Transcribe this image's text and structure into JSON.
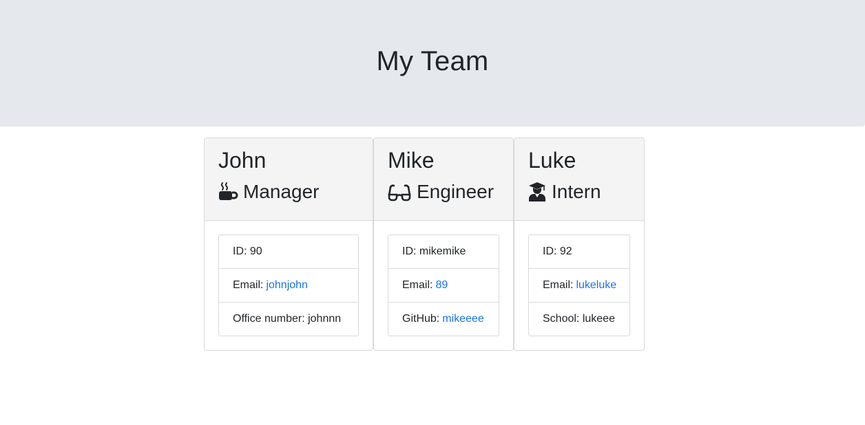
{
  "header": {
    "title": "My Team"
  },
  "cards": [
    {
      "name": "John",
      "role": "Manager",
      "role_icon": "coffee-icon",
      "id_label": "ID: 90",
      "email_label": "Email:",
      "email_value": "johnjohn",
      "extra_label": "Office number: johnnn",
      "extra_link": ""
    },
    {
      "name": "Mike",
      "role": "Engineer",
      "role_icon": "glasses-icon",
      "id_label": "ID: mikemike",
      "email_label": "Email:",
      "email_value": "89",
      "extra_label": "GitHub:",
      "extra_link": "mikeeee"
    },
    {
      "name": "Luke",
      "role": "Intern",
      "role_icon": "graduate-icon",
      "id_label": "ID: 92",
      "email_label": "Email:",
      "email_value": "lukeluke",
      "extra_label": "School: lukeee",
      "extra_link": ""
    }
  ],
  "colors": {
    "jumbotron_bg": "#e5e8ec",
    "link": "#1a73e8",
    "card_header_bg": "#f4f4f4",
    "border": "#d7d9dc",
    "text": "#212529"
  }
}
